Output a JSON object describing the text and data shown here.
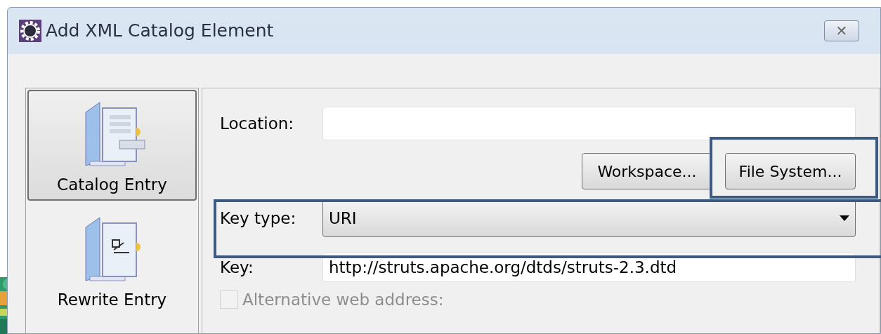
{
  "window": {
    "title": "Add XML Catalog Element",
    "close": "✕"
  },
  "entry_types": [
    {
      "label": "Catalog Entry",
      "kind": "catalog",
      "selected": true
    },
    {
      "label": "Rewrite Entry",
      "kind": "rewrite",
      "selected": false
    }
  ],
  "location": {
    "label": "Location:"
  },
  "buttons": [
    {
      "label": "Workspace..."
    },
    {
      "label": "File System...",
      "highlighted": true
    }
  ],
  "key_type": {
    "label": "Key type:",
    "value": "URI",
    "highlighted": true
  },
  "key": {
    "label": "Key:",
    "value": "http://struts.apache.org/dtds/struts-2.3.dtd"
  },
  "alternative": {
    "label": "Alternative web address:",
    "checked": false,
    "disabled": true
  }
}
